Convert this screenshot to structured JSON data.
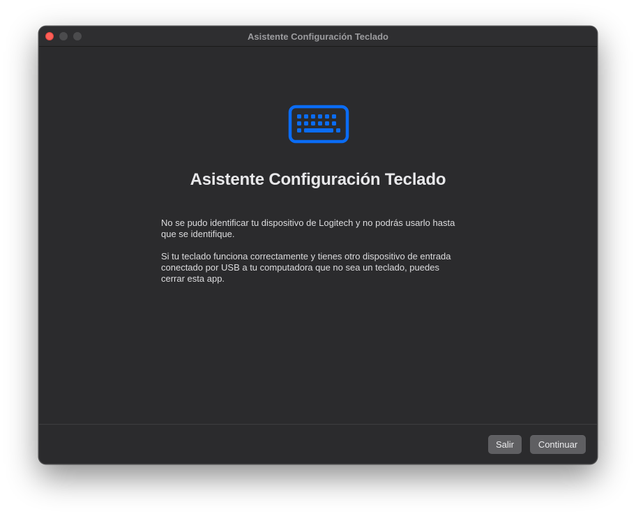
{
  "window": {
    "title": "Asistente Configuración Teclado"
  },
  "content": {
    "icon": "keyboard-icon",
    "heading": "Asistente Configuración Teclado",
    "paragraph1_line1": "No se pudo identificar tu dispositivo de Logitech y no podrás usarlo hasta",
    "paragraph1_line2": "que se identifique.",
    "paragraph2_line1": "Si tu teclado funciona correctamente y tienes otro dispositivo de entrada",
    "paragraph2_line2": "conectado por USB a tu computadora que no sea un teclado, puedes",
    "paragraph2_line3": "cerrar esta app."
  },
  "footer": {
    "quit_label": "Salir",
    "continue_label": "Continuar"
  },
  "colors": {
    "accent": "#0a6cf5",
    "close_button": "#fe5f57",
    "window_background": "#2b2b2d"
  }
}
